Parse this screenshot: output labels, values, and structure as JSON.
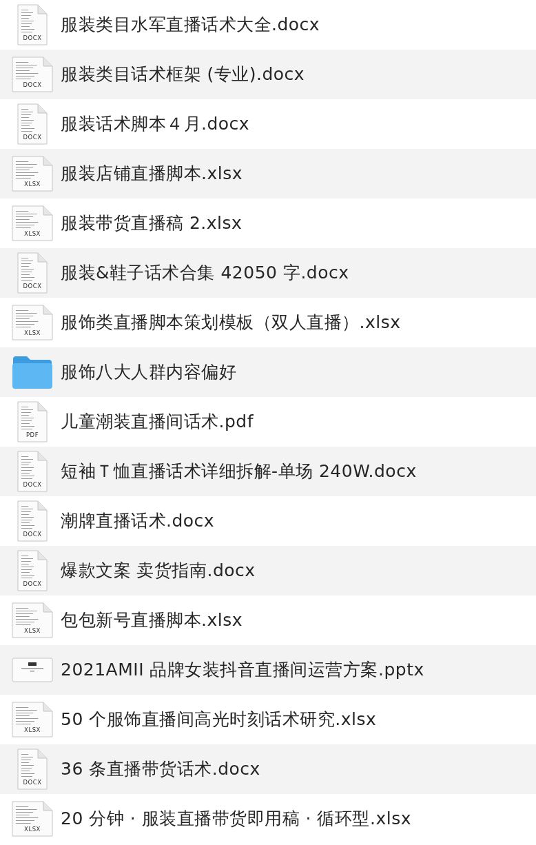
{
  "files": [
    {
      "name": "服装类目水军直播话术大全.docx",
      "kind": "portrait",
      "type_label": "DOCX"
    },
    {
      "name": "服装类目话术框架 (专业).docx",
      "kind": "landscape",
      "type_label": "DOCX"
    },
    {
      "name": "服装话术脚本４月.docx",
      "kind": "portrait",
      "type_label": "DOCX"
    },
    {
      "name": "服装店铺直播脚本.xlsx",
      "kind": "landscape",
      "type_label": "XLSX"
    },
    {
      "name": "服装带货直播稿 2.xlsx",
      "kind": "landscape",
      "type_label": "XLSX"
    },
    {
      "name": "服装&鞋子话术合集 42050 字.docx",
      "kind": "portrait",
      "type_label": "DOCX"
    },
    {
      "name": "服饰类直播脚本策划模板（双人直播）.xlsx",
      "kind": "landscape",
      "type_label": "XLSX"
    },
    {
      "name": "服饰八大人群内容偏好",
      "kind": "folder"
    },
    {
      "name": "儿童潮装直播间话术.pdf",
      "kind": "portrait",
      "type_label": "PDF"
    },
    {
      "name": "短袖Ｔ恤直播话术详细拆解-单场 240W.docx",
      "kind": "portrait",
      "type_label": "DOCX"
    },
    {
      "name": "潮牌直播话术.docx",
      "kind": "portrait",
      "type_label": "DOCX"
    },
    {
      "name": "爆款文案 卖货指南.docx",
      "kind": "portrait",
      "type_label": "DOCX"
    },
    {
      "name": "包包新号直播脚本.xlsx",
      "kind": "landscape",
      "type_label": "XLSX"
    },
    {
      "name": "2021AMII 品牌女装抖音直播间运营方案.pptx",
      "kind": "slides"
    },
    {
      "name": "50 个服饰直播间高光时刻话术研究.xlsx",
      "kind": "landscape",
      "type_label": "XLSX"
    },
    {
      "name": "36 条直播带货话术.docx",
      "kind": "portrait",
      "type_label": "DOCX"
    },
    {
      "name": "20 分钟 · 服装直播带货即用稿 · 循环型.xlsx",
      "kind": "landscape",
      "type_label": "XLSX"
    }
  ]
}
